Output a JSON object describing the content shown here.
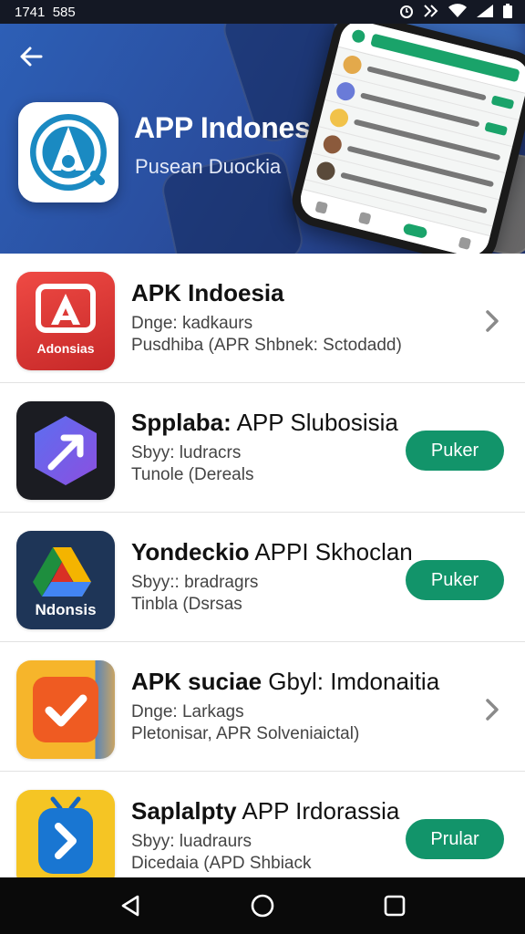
{
  "status_bar": {
    "time": "1741",
    "extra": "585",
    "icons": [
      "alarm-icon",
      "nfc-icon",
      "wifi-icon",
      "signal-icon",
      "battery-icon"
    ]
  },
  "header": {
    "title": "APP Indonesia",
    "subtitle": "Pusean Duockia",
    "back_icon": "arrow-left-icon",
    "accent": "#12946a"
  },
  "apps": [
    {
      "name_bold": "APK Indoesia",
      "name_light": "",
      "line1": "Dnge: kadkaurs",
      "line2": "Pusdhiba (APR Shbnek: Sctodadd)",
      "icon_label": "Adonsias",
      "action": "chevron"
    },
    {
      "name_bold": "Spplaba:",
      "name_light": " APP Slubosisia",
      "line1": "Sbyy: ludracrs",
      "line2": "Tunole (Dereals",
      "icon_label": "",
      "action": "button",
      "button_label": "Puker"
    },
    {
      "name_bold": "Yondeckio",
      "name_light": " APPI Skhoclan",
      "line1": "Sbyy:: bradragrs",
      "line2": "Tinbla (Dsrsas",
      "icon_label": "Ndonsis",
      "action": "button",
      "button_label": "Puker"
    },
    {
      "name_bold": "APK suciae",
      "name_light": " Gbyl: Imdonaitia",
      "line1": "Dnge: Larkags",
      "line2": "Pletonisar, APR Solveniaictal)",
      "icon_label": "",
      "action": "chevron"
    },
    {
      "name_bold": "Saplalpty",
      "name_light": " APP Irdorassia",
      "line1": "Sbyy: luadraurs",
      "line2": "Dicedaia (APD Shbiack",
      "icon_label": "",
      "action": "button",
      "button_label": "Prular"
    }
  ],
  "nav": [
    "back-triangle-icon",
    "home-circle-icon",
    "recents-square-icon"
  ]
}
